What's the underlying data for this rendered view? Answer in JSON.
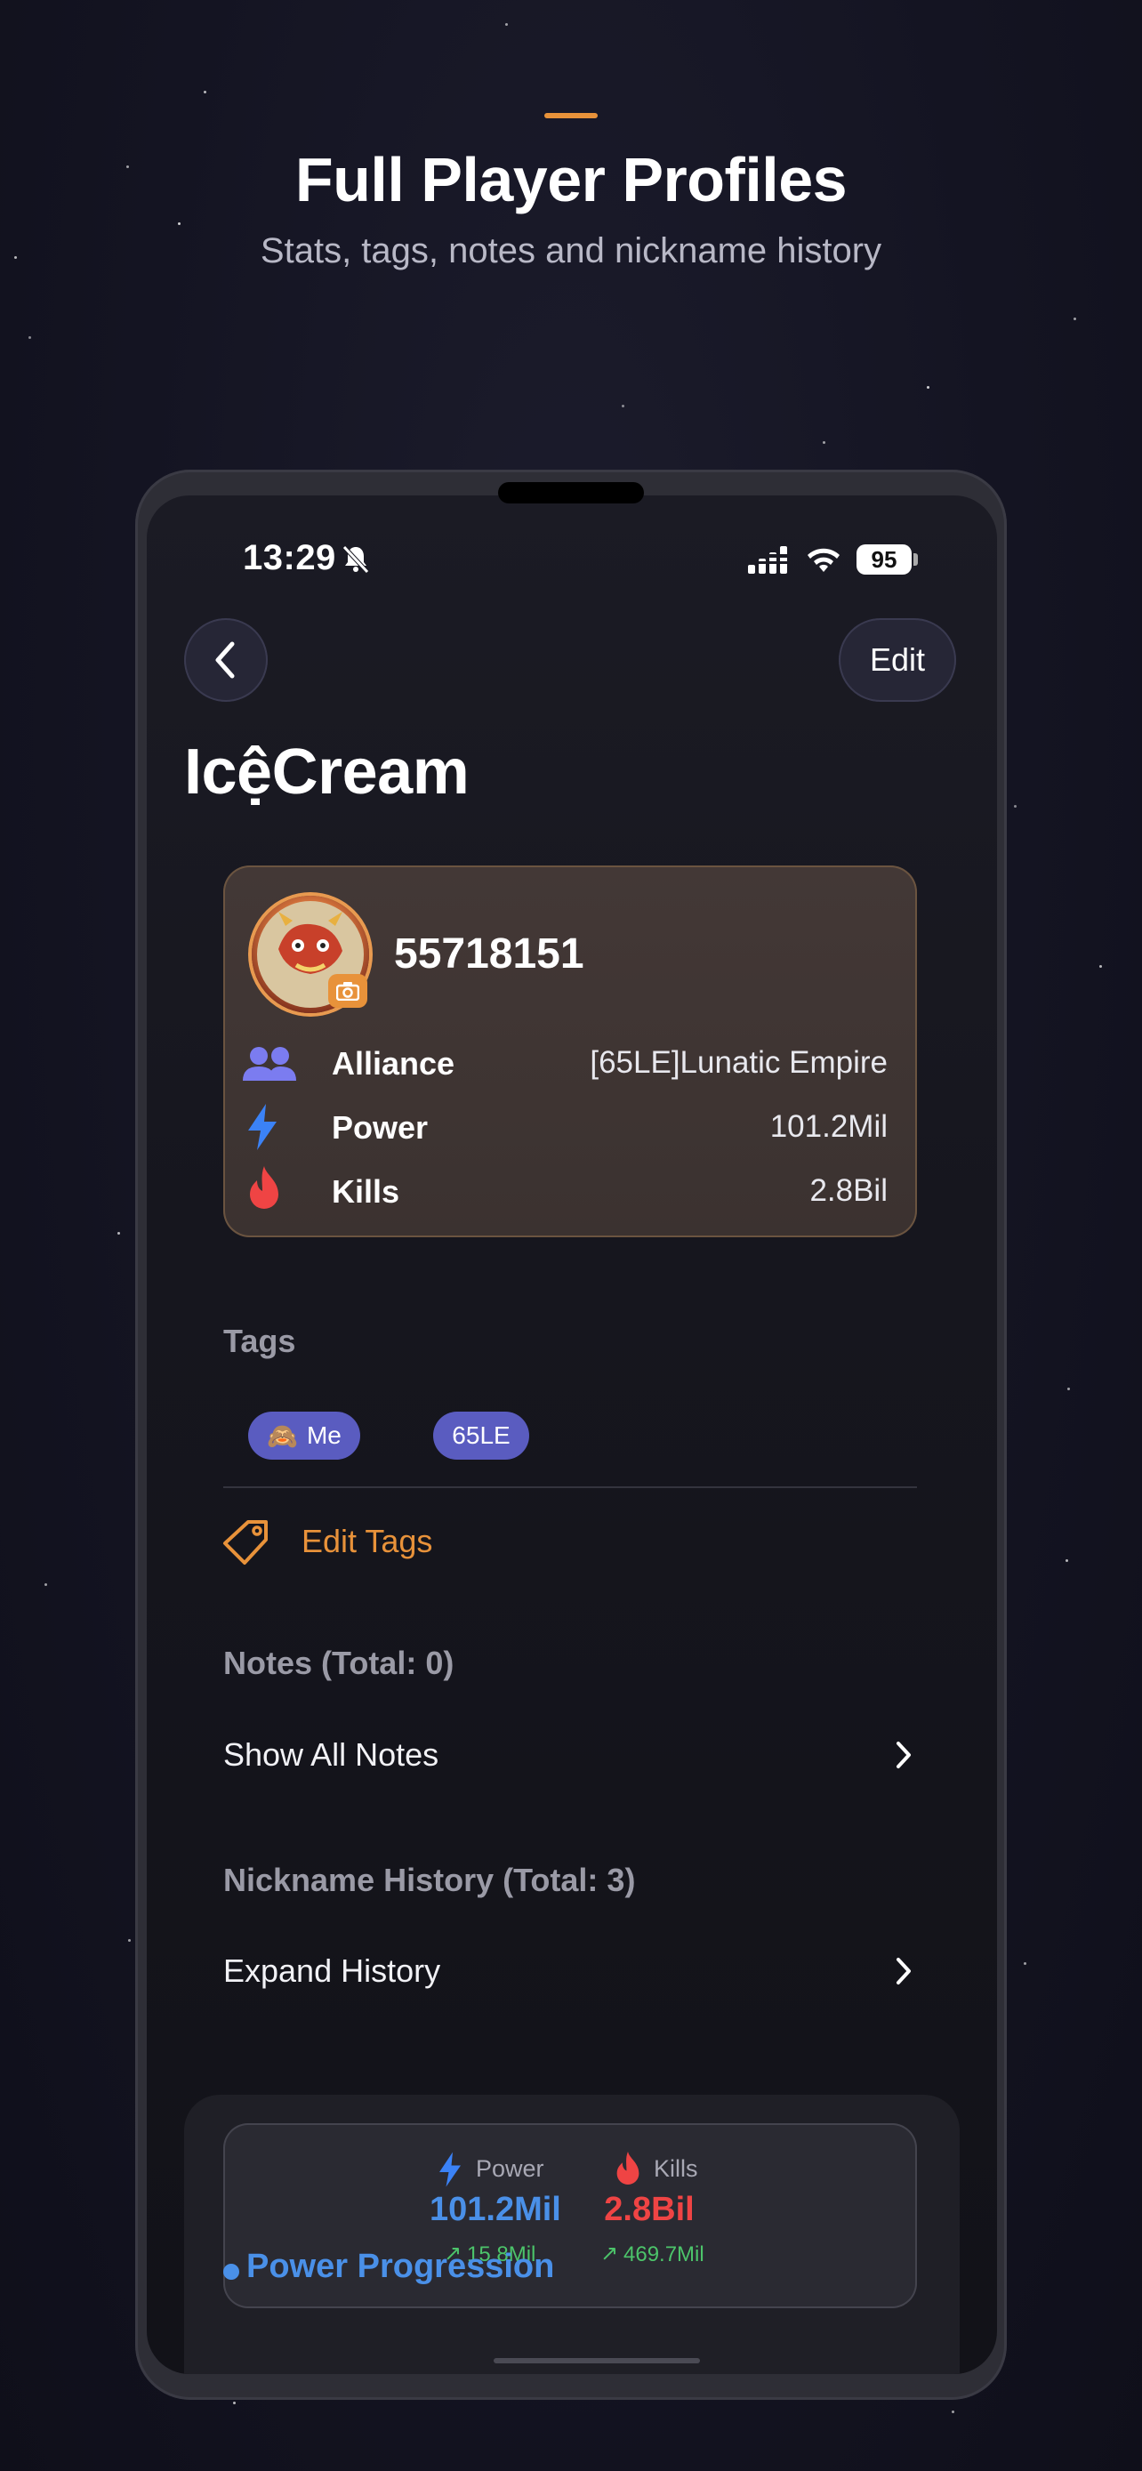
{
  "header": {
    "title": "Full Player Profiles",
    "subtitle": "Stats, tags, notes and nickname history"
  },
  "status_bar": {
    "time": "13:29",
    "battery": "95"
  },
  "nav": {
    "edit_label": "Edit"
  },
  "player": {
    "name": "IcệCream",
    "id": "55718151",
    "rows": [
      {
        "label": "Alliance",
        "value": "[65LE]Lunatic Empire",
        "icon": "alliance-people-icon",
        "color": "#7b7cf0"
      },
      {
        "label": "Power",
        "value": "101.2Mil",
        "icon": "lightning-icon",
        "color": "#3b82f6"
      },
      {
        "label": "Kills",
        "value": "2.8Bil",
        "icon": "flame-icon",
        "color": "#ef4444"
      }
    ]
  },
  "tags": {
    "label": "Tags",
    "items": [
      {
        "emoji": "🙈",
        "text": "Me"
      },
      {
        "emoji": "",
        "text": "65LE"
      }
    ],
    "edit_label": "Edit Tags"
  },
  "notes": {
    "label": "Notes (Total: 0)",
    "action": "Show All Notes"
  },
  "nickname_history": {
    "label": "Nickname History (Total: 3)",
    "action": "Expand History"
  },
  "summary": {
    "power_label": "Power",
    "power_value": "101.2Mil",
    "power_delta": "15.8Mil",
    "kills_label": "Kills",
    "kills_value": "2.8Bil",
    "kills_delta": "469.7Mil"
  },
  "progression": {
    "title": "Power Progression"
  },
  "colors": {
    "accent": "#e8923a",
    "power": "#4a90e8",
    "kills": "#ef4444",
    "tag": "#5a5cc0",
    "delta": "#4cc46a"
  }
}
